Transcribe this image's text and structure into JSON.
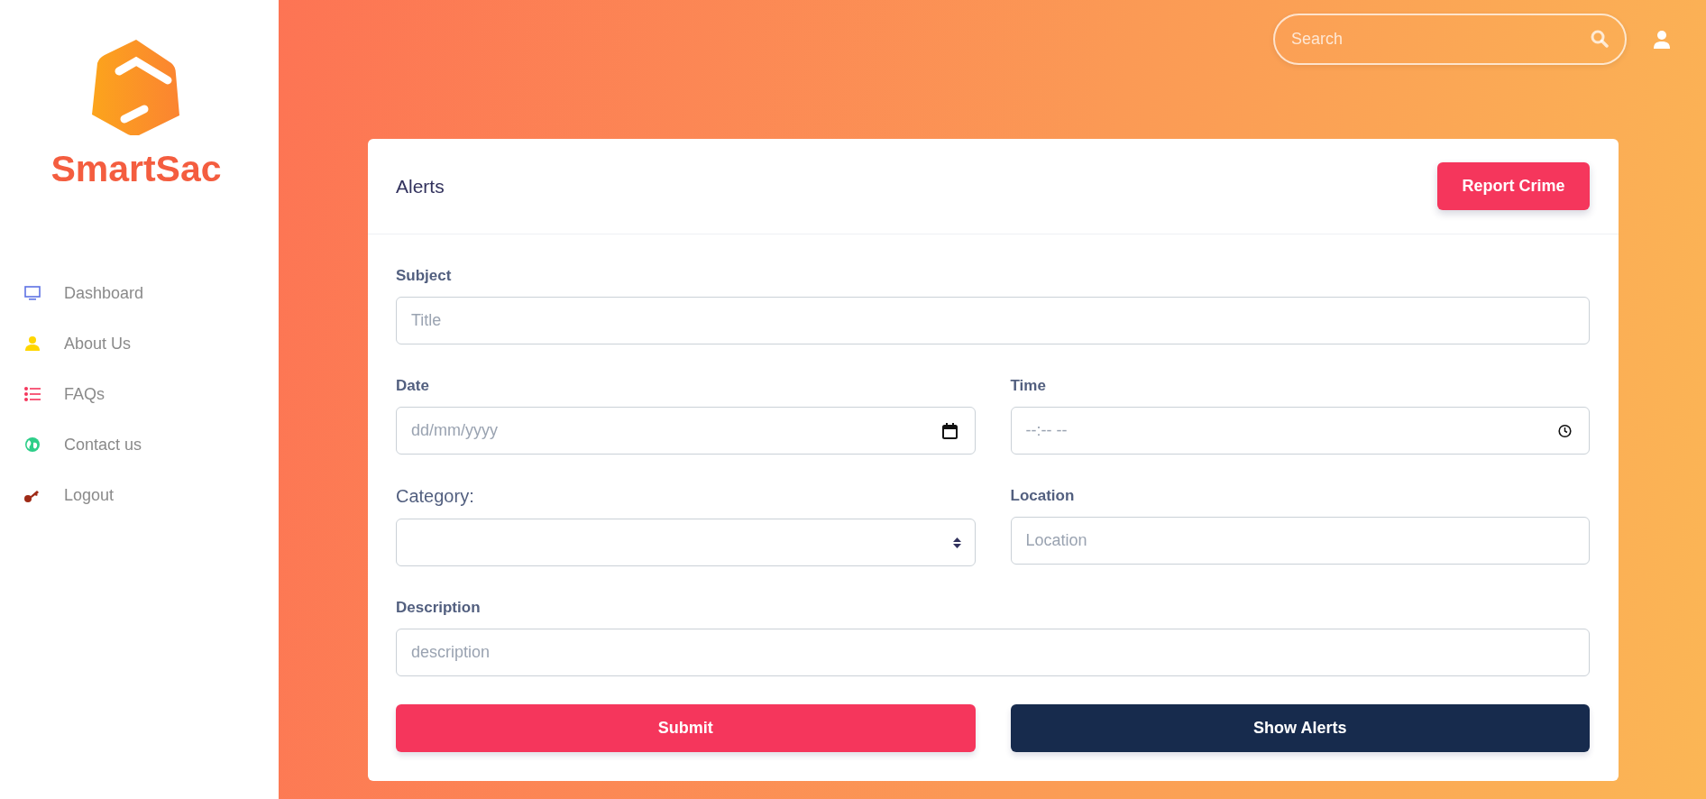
{
  "sidebar": {
    "brand": "SmartSac",
    "items": [
      {
        "label": "Dashboard"
      },
      {
        "label": "About Us"
      },
      {
        "label": "FAQs"
      },
      {
        "label": "Contact us"
      },
      {
        "label": "Logout"
      }
    ]
  },
  "header": {
    "search": {
      "placeholder": "Search"
    }
  },
  "card": {
    "title": "Alerts",
    "action": "Report Crime",
    "rows": [
      [
        {
          "kind": "text",
          "label": "Subject",
          "placeholder": "Title"
        }
      ],
      [
        {
          "kind": "date",
          "label": "Date",
          "placeholder": "dd/mm/yyyy"
        },
        {
          "kind": "time",
          "label": "Time",
          "placeholder": "--:-- --"
        }
      ],
      [
        {
          "kind": "select",
          "label": "Category:"
        },
        {
          "kind": "text",
          "label": "Location",
          "placeholder": "Location"
        }
      ],
      [
        {
          "kind": "text",
          "label": "Description",
          "placeholder": "description"
        }
      ]
    ],
    "buttons": [
      {
        "kind": "primary",
        "label": "Submit"
      },
      {
        "kind": "dark",
        "label": "Show Alerts"
      }
    ]
  }
}
